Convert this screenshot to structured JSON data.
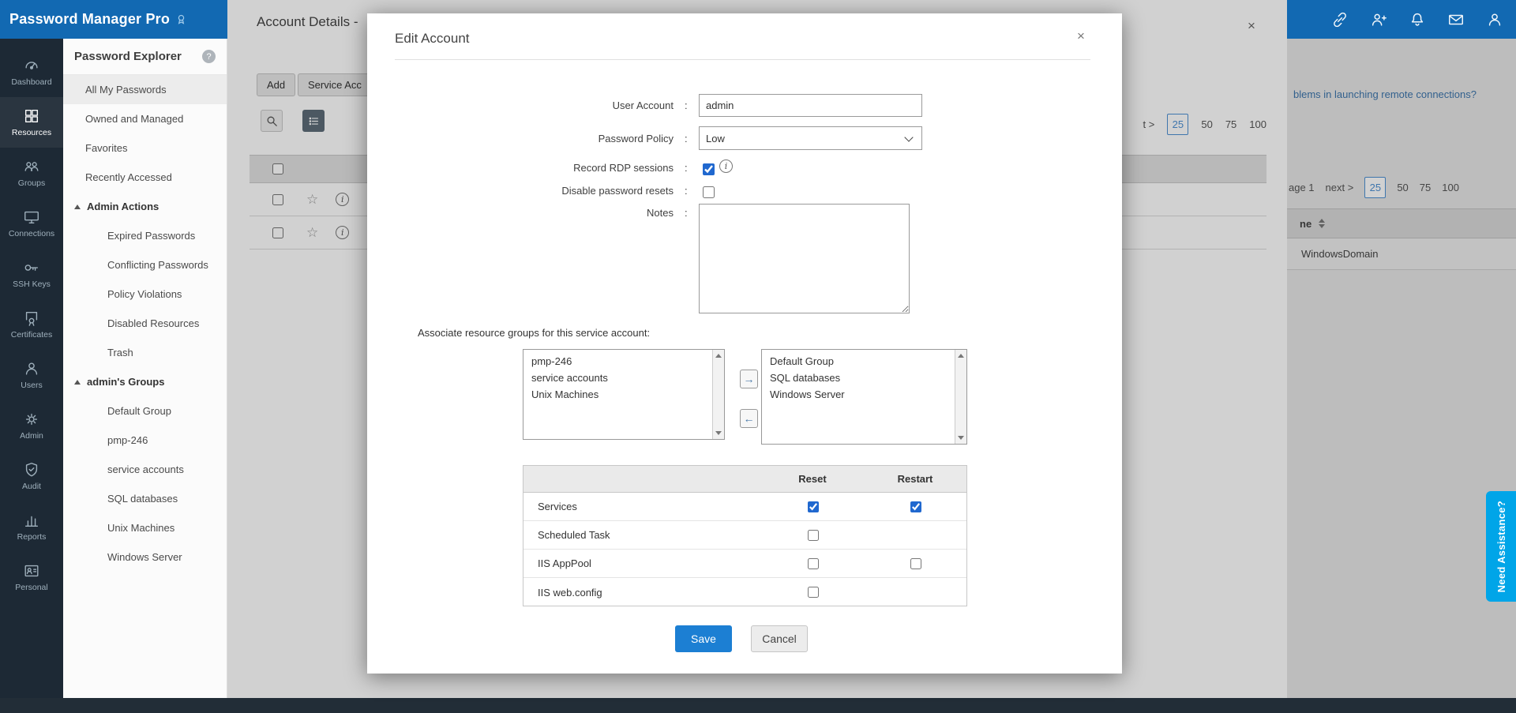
{
  "colors": {
    "topbar": "#1269b2",
    "sidebar": "#1d2935",
    "save_button": "#1c7fd3",
    "assist_tab": "#00a5e8",
    "selected_page_border": "#4d90d4"
  },
  "glyphs": {
    "close": "×",
    "star": "☆",
    "info": "i",
    "help": "?",
    "move_right": "→",
    "move_left": "←"
  },
  "topbar": {
    "logo_text": "Password Manager Pro",
    "icon_names": [
      "link-icon",
      "add-user-icon",
      "bell-icon",
      "mail-icon",
      "user-icon"
    ]
  },
  "sidebar": {
    "items": [
      {
        "label": "Dashboard"
      },
      {
        "label": "Resources"
      },
      {
        "label": "Groups"
      },
      {
        "label": "Connections"
      },
      {
        "label": "SSH Keys"
      },
      {
        "label": "Certificates"
      },
      {
        "label": "Users"
      },
      {
        "label": "Admin"
      },
      {
        "label": "Audit"
      },
      {
        "label": "Reports"
      },
      {
        "label": "Personal"
      }
    ]
  },
  "explorer": {
    "title": "Password Explorer",
    "items": [
      {
        "label": "All My Passwords"
      },
      {
        "label": "Owned and Managed"
      },
      {
        "label": "Favorites"
      },
      {
        "label": "Recently Accessed"
      },
      {
        "label": "Admin Actions"
      },
      {
        "label": "Expired Passwords"
      },
      {
        "label": "Conflicting Passwords"
      },
      {
        "label": "Policy Violations"
      },
      {
        "label": "Disabled Resources"
      },
      {
        "label": "Trash"
      },
      {
        "label": "admin's Groups"
      },
      {
        "label": "Default Group"
      },
      {
        "label": "pmp-246"
      },
      {
        "label": "service accounts"
      },
      {
        "label": "SQL databases"
      },
      {
        "label": "Unix Machines"
      },
      {
        "label": "Windows Server"
      }
    ]
  },
  "panel": {
    "title": "Account Details -",
    "add_button": "Add",
    "service_button": "Service Acc",
    "pagination": {
      "prefix": "t >",
      "pages": [
        "25",
        "50",
        "75",
        "100"
      ],
      "selected": "25"
    }
  },
  "background": {
    "link_text": "blems in launching remote connections?",
    "pagination": {
      "page_label": "age 1",
      "next_label": "next >",
      "pages": [
        "25",
        "50",
        "75",
        "100"
      ],
      "selected": "25"
    },
    "column_header": "ne",
    "cell_value": "WindowsDomain"
  },
  "assist_tab": {
    "label": "Need Assistance?"
  },
  "modal": {
    "title": "Edit Account",
    "colon": ":",
    "fields": {
      "user_account": {
        "label": "User Account",
        "value": "admin"
      },
      "password_policy": {
        "label": "Password Policy",
        "value": "Low"
      },
      "record_rdp": {
        "label": "Record RDP sessions",
        "checked": true,
        "checked_attr": "checked"
      },
      "disable_resets": {
        "label": "Disable password resets",
        "checked": false
      },
      "notes": {
        "label": "Notes",
        "value": ""
      }
    },
    "associate_label": "Associate resource groups for this service account:",
    "available_groups": [
      "pmp-246",
      "service accounts",
      "Unix Machines"
    ],
    "selected_groups": [
      "Default Group",
      "SQL databases",
      "Windows Server"
    ],
    "table": {
      "columns": [
        "Reset",
        "Restart"
      ],
      "rows": [
        {
          "label": "Services",
          "reset": true,
          "reset_attr": "checked",
          "restart": true,
          "restart_attr": "checked"
        },
        {
          "label": "Scheduled Task",
          "reset": false
        },
        {
          "label": "IIS AppPool",
          "reset": false,
          "restart": false
        },
        {
          "label": "IIS web.config",
          "reset": false
        }
      ]
    },
    "save_label": "Save",
    "cancel_label": "Cancel"
  }
}
